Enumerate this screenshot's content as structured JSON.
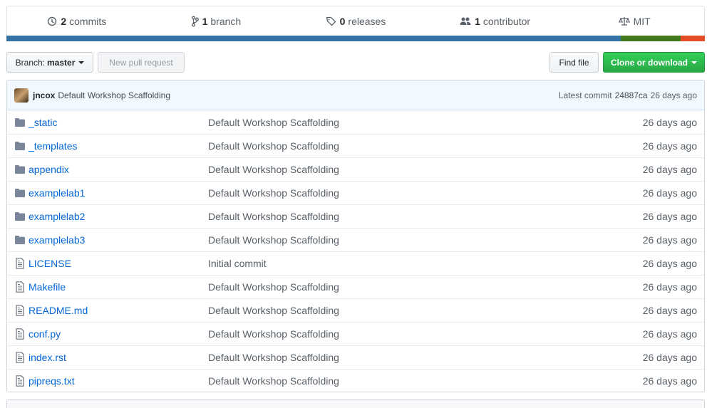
{
  "summary": {
    "commits_count": "2",
    "commits_label": "commits",
    "branch_count": "1",
    "branch_label": "branch",
    "releases_count": "0",
    "releases_label": "releases",
    "contributor_count": "1",
    "contributor_label": "contributor",
    "license": "MIT"
  },
  "language_bar": [
    {
      "color": "#3572a5",
      "fraction": 0.88
    },
    {
      "color": "#427819",
      "fraction": 0.085
    },
    {
      "color": "#e34c26",
      "fraction": 0.035
    }
  ],
  "toolbar": {
    "branch_prefix": "Branch:",
    "branch_name": "master",
    "new_pr": "New pull request",
    "find_file": "Find file",
    "clone": "Clone or download"
  },
  "latest_commit": {
    "author": "jncox",
    "message": "Default Workshop Scaffolding",
    "label": "Latest commit",
    "sha": "24887ca",
    "age": "26 days ago"
  },
  "files": [
    {
      "type": "dir",
      "name": "_static",
      "message": "Default Workshop Scaffolding",
      "age": "26 days ago"
    },
    {
      "type": "dir",
      "name": "_templates",
      "message": "Default Workshop Scaffolding",
      "age": "26 days ago"
    },
    {
      "type": "dir",
      "name": "appendix",
      "message": "Default Workshop Scaffolding",
      "age": "26 days ago"
    },
    {
      "type": "dir",
      "name": "examplelab1",
      "message": "Default Workshop Scaffolding",
      "age": "26 days ago"
    },
    {
      "type": "dir",
      "name": "examplelab2",
      "message": "Default Workshop Scaffolding",
      "age": "26 days ago"
    },
    {
      "type": "dir",
      "name": "examplelab3",
      "message": "Default Workshop Scaffolding",
      "age": "26 days ago"
    },
    {
      "type": "file",
      "name": "LICENSE",
      "message": "Initial commit",
      "age": "26 days ago"
    },
    {
      "type": "file",
      "name": "Makefile",
      "message": "Default Workshop Scaffolding",
      "age": "26 days ago"
    },
    {
      "type": "file",
      "name": "README.md",
      "message": "Default Workshop Scaffolding",
      "age": "26 days ago"
    },
    {
      "type": "file",
      "name": "conf.py",
      "message": "Default Workshop Scaffolding",
      "age": "26 days ago"
    },
    {
      "type": "file",
      "name": "index.rst",
      "message": "Default Workshop Scaffolding",
      "age": "26 days ago"
    },
    {
      "type": "file",
      "name": "pipreqs.txt",
      "message": "Default Workshop Scaffolding",
      "age": "26 days ago"
    }
  ]
}
